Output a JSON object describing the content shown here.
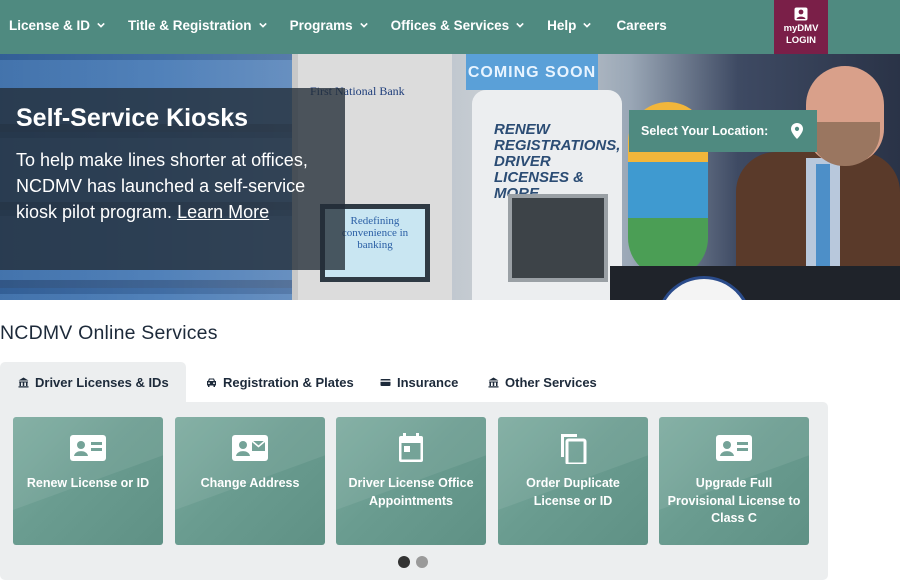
{
  "nav": {
    "items": [
      {
        "label": "License & ID",
        "dropdown": true
      },
      {
        "label": "Title & Registration",
        "dropdown": true
      },
      {
        "label": "Programs",
        "dropdown": true
      },
      {
        "label": "Offices & Services",
        "dropdown": true
      },
      {
        "label": "Help",
        "dropdown": true
      },
      {
        "label": "Careers",
        "dropdown": false
      }
    ],
    "mydmv": {
      "line1": "myDMV",
      "line2": "LOGIN",
      "icon": "user-badge-icon"
    }
  },
  "hero": {
    "title": "Self-Service Kiosks",
    "text": "To help make lines shorter at offices, NCDMV has launched a self-service kiosk pilot program. ",
    "link": "Learn More",
    "location_button": "Select Your Location:",
    "photo_texts": {
      "bank": "First National Bank",
      "screen": "Redefining convenience in banking",
      "sign": "COMING SOON",
      "kiosk": "RENEW REGISTRATIONS, DRIVER LICENSES & MORE"
    }
  },
  "services": {
    "title": "NCDMV Online Services",
    "tabs": [
      {
        "label": "Driver Licenses & IDs",
        "icon": "building-icon",
        "active": true
      },
      {
        "label": "Registration & Plates",
        "icon": "car-icon",
        "active": false
      },
      {
        "label": "Insurance",
        "icon": "card-icon",
        "active": false
      },
      {
        "label": "Other Services",
        "icon": "building-icon",
        "active": false
      }
    ],
    "cards": [
      {
        "label": "Renew License or ID",
        "icon": "id-card-icon"
      },
      {
        "label": "Change Address",
        "icon": "id-card-mail-icon"
      },
      {
        "label": "Driver License Office Appointments",
        "icon": "calendar-icon"
      },
      {
        "label": "Order Duplicate License or ID",
        "icon": "copy-icon"
      },
      {
        "label": "Upgrade Full Provisional License to Class C",
        "icon": "id-card-icon"
      }
    ],
    "carousel": {
      "pages": 2,
      "current": 1
    }
  },
  "colors": {
    "nav_bg": "#4f8a80",
    "mydmv_bg": "#7a1f48",
    "card_bg": "#6a9c90",
    "panel_bg": "#eceeef"
  }
}
